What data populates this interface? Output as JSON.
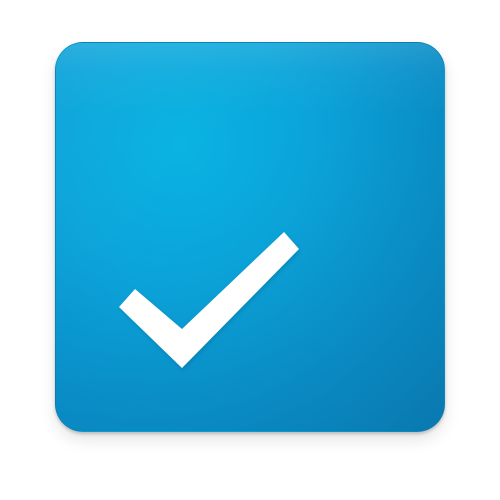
{
  "app": {
    "icon": "checkmark-icon",
    "colors": {
      "tile_highlight": "#08b3e2",
      "tile_mid": "#0a8fc9",
      "tile_dark": "#0b7fba",
      "check": "#ffffff"
    }
  }
}
